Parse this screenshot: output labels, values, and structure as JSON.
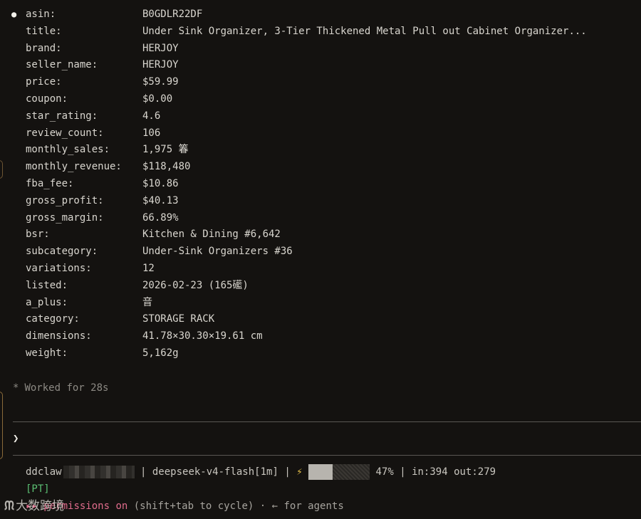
{
  "product": {
    "bullet": "●",
    "fields": [
      {
        "key": "asin:",
        "value": "B0GDLR22DF"
      },
      {
        "key": "title:",
        "value": "Under Sink Organizer, 3-Tier Thickened Metal Pull out Cabinet Organizer..."
      },
      {
        "key": "brand:",
        "value": "HERJOY"
      },
      {
        "key": "seller_name:",
        "value": "HERJOY"
      },
      {
        "key": "price:",
        "value": "$59.99"
      },
      {
        "key": "coupon:",
        "value": "$0.00"
      },
      {
        "key": "star_rating:",
        "value": "4.6"
      },
      {
        "key": "review_count:",
        "value": "106"
      },
      {
        "key": "monthly_sales:",
        "value": "1,975 箺"
      },
      {
        "key": "monthly_revenue:",
        "value": "$118,480"
      },
      {
        "key": "fba_fee:",
        "value": "$10.86"
      },
      {
        "key": "gross_profit:",
        "value": "$40.13"
      },
      {
        "key": "gross_margin:",
        "value": "66.89%"
      },
      {
        "key": "bsr:",
        "value": "Kitchen & Dining #6,642"
      },
      {
        "key": "subcategory:",
        "value": "Under-Sink Organizers #36"
      },
      {
        "key": "variations:",
        "value": "12"
      },
      {
        "key": "listed:",
        "value": "2026-02-23 (165礷)"
      },
      {
        "key": "a_plus:",
        "value": "音"
      },
      {
        "key": "category:",
        "value": "STORAGE RACK"
      },
      {
        "key": "dimensions:",
        "value": "41.78×30.30×19.61 cm"
      },
      {
        "key": "weight:",
        "value": "5,162g"
      }
    ]
  },
  "worked": {
    "icon": "*",
    "text": "Worked for 28s"
  },
  "prompt": {
    "symbol": "❯"
  },
  "status": {
    "user": "ddclaw",
    "sep1": " | ",
    "model": "deepseek-v4-flash[1m]",
    "sep2": " | ",
    "bolt": "⚡",
    "context_percent": 47,
    "context_label": " 47% | ",
    "tokens": "in:394 out:279"
  },
  "mode": {
    "label": "[PT]"
  },
  "permissions": {
    "prefix": "▸▸ ",
    "on_label": "permissions on",
    "hint": " (shift+tab to cycle) · ← for agents"
  },
  "watermark": {
    "text": "大数跨境"
  },
  "colors": {
    "background": "#141210",
    "text": "#d9d6cf",
    "muted": "#8d8a84",
    "mode_green": "#5bbf73",
    "permissions_pink": "#e06c8c",
    "bolt_yellow": "#e8c24a"
  }
}
